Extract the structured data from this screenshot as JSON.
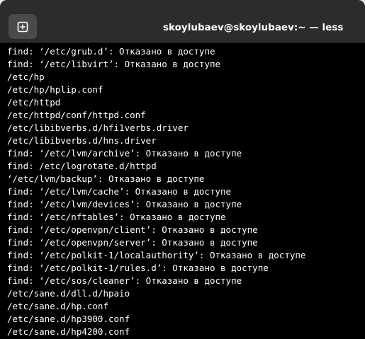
{
  "window": {
    "title": "skoylubaev@skoylubaev:~ — less"
  },
  "icons": {
    "new_tab": "new-tab-plus-icon"
  },
  "colors": {
    "titlebar": "#2c2c2c",
    "button": "#4a4a4a",
    "terminal_bg": "#000000",
    "terminal_fg": "#ffffff"
  },
  "terminal": {
    "lines": [
      "find: ‘/etc/grub.d’: Отказано в доступе",
      "find: ‘/etc/libvirt’: Отказано в доступе",
      "/etc/hp",
      "/etc/hp/hplip.conf",
      "/etc/httpd",
      "/etc/httpd/conf/httpd.conf",
      "/etc/libibverbs.d/hfi1verbs.driver",
      "/etc/libibverbs.d/hns.driver",
      "find: ‘/etc/lvm/archive’: Отказано в доступе",
      "find: /etc/logrotate.d/httpd",
      "‘/etc/lvm/backup’: Отказано в доступе",
      "find: ‘/etc/lvm/cache’: Отказано в доступе",
      "find: ‘/etc/lvm/devices’: Отказано в доступе",
      "find: ‘/etc/nftables’: Отказано в доступе",
      "find: ‘/etc/openvpn/client’: Отказано в доступе",
      "find: ‘/etc/openvpn/server’: Отказано в доступе",
      "find: ‘/etc/polkit-1/localauthority’: Отказано в доступе",
      "find: ‘/etc/polkit-1/rules.d’: Отказано в доступе",
      "find: ‘/etc/sos/cleaner’: Отказано в доступе",
      "/etc/sane.d/dll.d/hpaio",
      "/etc/sane.d/hp.conf",
      "/etc/sane.d/hp3900.conf",
      "/etc/sane.d/hp4200.conf"
    ]
  }
}
